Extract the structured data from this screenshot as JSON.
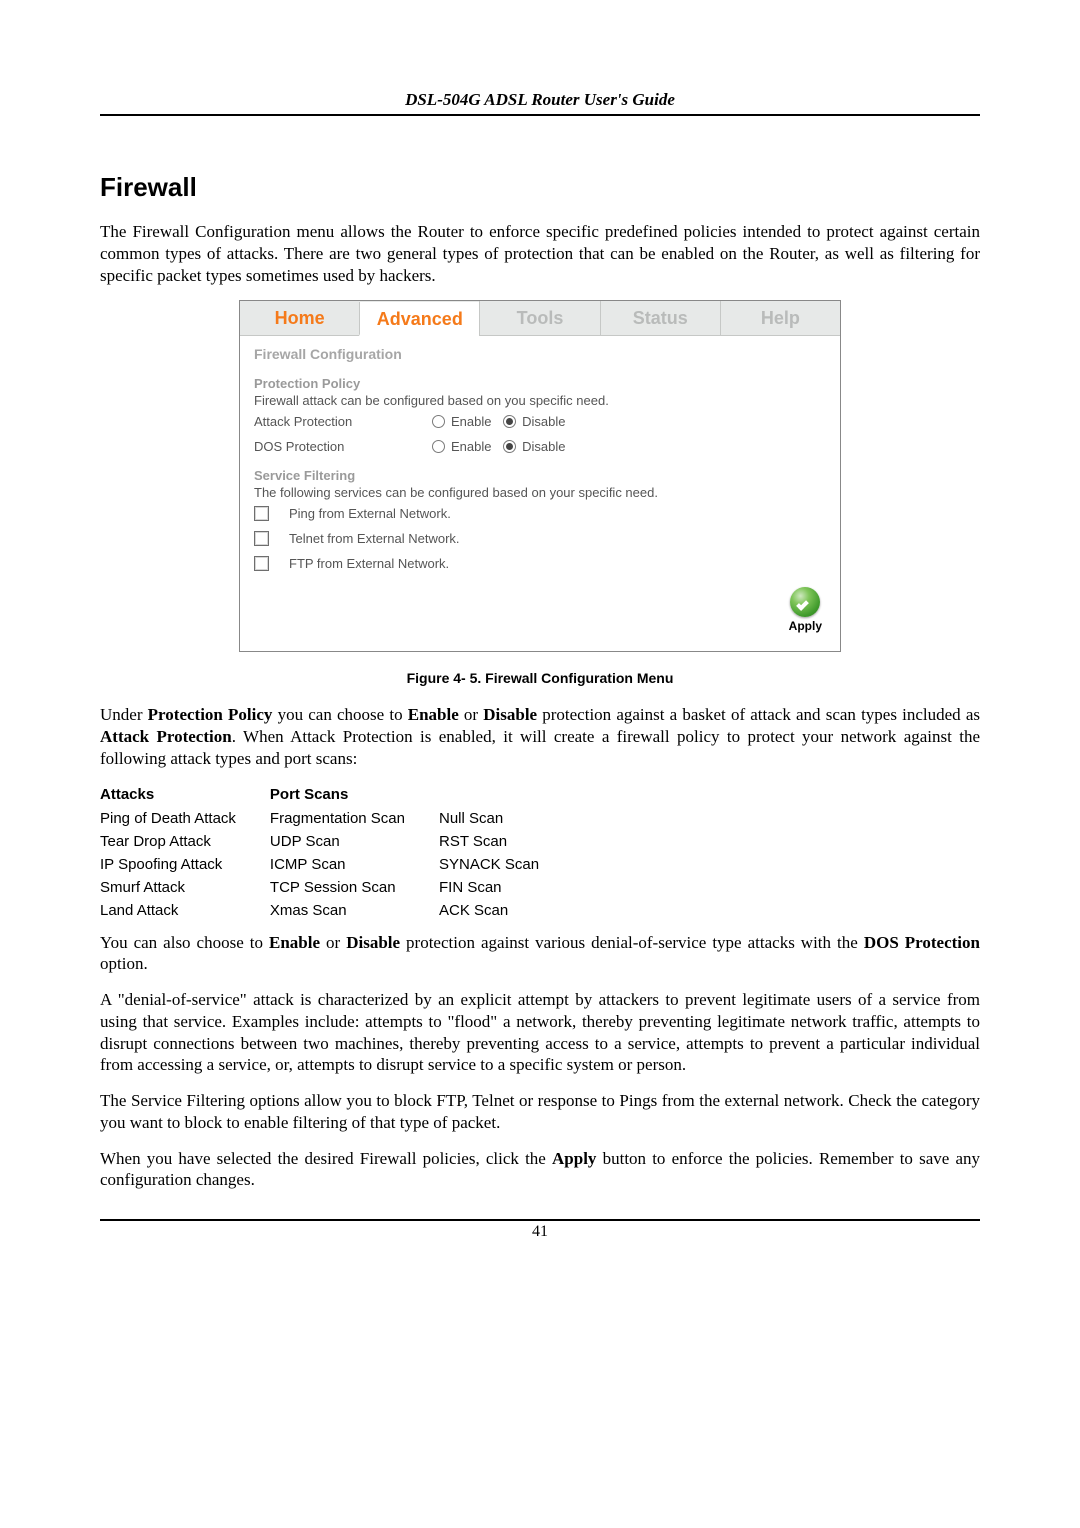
{
  "header": {
    "title": "DSL-504G ADSL Router User's Guide"
  },
  "section": {
    "title": "Firewall"
  },
  "intro": "The Firewall Configuration menu allows the Router to enforce specific predefined policies intended to protect against certain common types of attacks. There are two general types of protection that can be enabled on the Router, as well as filtering for specific packet types sometimes used by hackers.",
  "screenshot": {
    "tabs": {
      "home": "Home",
      "advanced": "Advanced",
      "tools": "Tools",
      "status": "Status",
      "help": "Help"
    },
    "title": "Firewall Configuration",
    "protection": {
      "heading": "Protection Policy",
      "desc": "Firewall attack can be configured based on you specific need.",
      "attack_label": "Attack Protection",
      "dos_label": "DOS Protection",
      "enable": "Enable",
      "disable": "Disable",
      "attack_value": "Disable",
      "dos_value": "Disable"
    },
    "filtering": {
      "heading": "Service Filtering",
      "desc": "The following services can be configured based on your specific need.",
      "items": {
        "ping": "Ping from External Network.",
        "telnet": "Telnet from External Network.",
        "ftp": "FTP from External Network."
      }
    },
    "apply": "Apply"
  },
  "figure_caption": "Figure 4- 5. Firewall Configuration Menu",
  "para_under": {
    "pre": "Under ",
    "pp": "Protection Policy",
    "mid1": " you can choose to ",
    "en": "Enable",
    "or": " or ",
    "dis": "Disable",
    "mid2": " protection against a basket of attack and scan types included as ",
    "ap": "Attack Protection",
    "post": ". When Attack Protection is enabled, it will create a firewall policy to protect your network against the following attack types and port scans:"
  },
  "table": {
    "headers": {
      "attacks": "Attacks",
      "scans": "Port Scans"
    },
    "rows": [
      {
        "a": "Ping of Death Attack",
        "s1": "Fragmentation Scan",
        "s2": "Null Scan"
      },
      {
        "a": "Tear Drop Attack",
        "s1": "UDP Scan",
        "s2": "RST Scan"
      },
      {
        "a": "IP Spoofing Attack",
        "s1": "ICMP Scan",
        "s2": "SYNACK Scan"
      },
      {
        "a": "Smurf Attack",
        "s1": "TCP Session Scan",
        "s2": "FIN Scan"
      },
      {
        "a": "Land Attack",
        "s1": "Xmas Scan",
        "s2": "ACK Scan"
      }
    ]
  },
  "para_dos": {
    "pre": "You can also choose to ",
    "en": "Enable",
    "or": " or ",
    "dis": "Disable",
    "mid": " protection against various denial-of-service type attacks with the ",
    "dp": "DOS Protection",
    "post": " option."
  },
  "para_denial": "A \"denial-of-service\" attack is characterized by an explicit attempt by attackers to prevent legitimate users of a service from using that service. Examples include: attempts to \"flood\" a network, thereby preventing legitimate network traffic, attempts to disrupt connections between two machines, thereby preventing access to a service, attempts to prevent a particular individual from accessing a service, or, attempts to disrupt service to a specific system or person.",
  "para_filter": "The Service Filtering options allow you to block FTP, Telnet or response to Pings from the external network. Check the category you want to block to enable filtering of that type of packet.",
  "para_apply": {
    "pre": "When you have selected the desired Firewall policies, click the ",
    "btn": "Apply",
    "post": " button to enforce the policies. Remember to save any configuration changes."
  },
  "page_number": "41"
}
